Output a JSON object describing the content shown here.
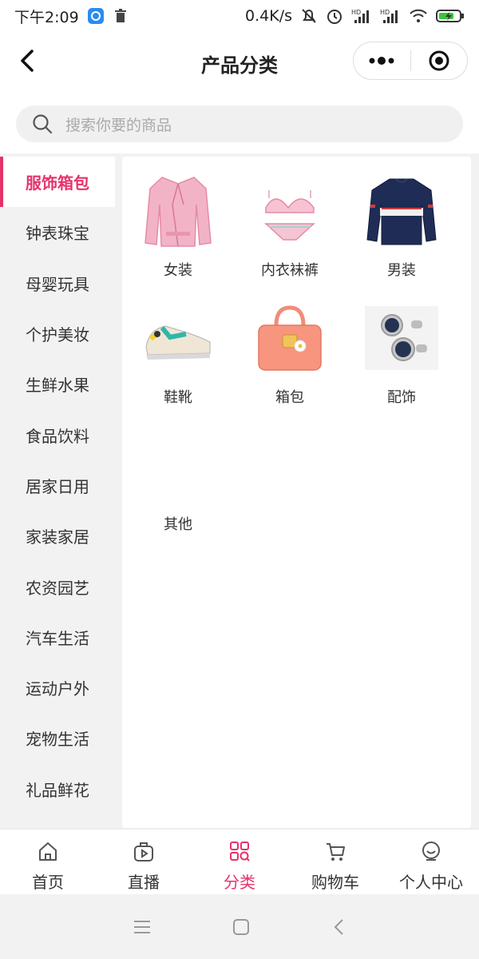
{
  "status": {
    "time": "下午2:09",
    "speed": "0.4K/s",
    "hd1": "HD",
    "hd2": "HD"
  },
  "nav": {
    "title": "产品分类"
  },
  "search": {
    "placeholder": "搜索你要的商品"
  },
  "sidebar": {
    "items": [
      {
        "label": "服饰箱包",
        "active": true
      },
      {
        "label": "钟表珠宝"
      },
      {
        "label": "母婴玩具"
      },
      {
        "label": "个护美妆"
      },
      {
        "label": "生鲜水果"
      },
      {
        "label": "食品饮料"
      },
      {
        "label": "居家日用"
      },
      {
        "label": "家装家居"
      },
      {
        "label": "农资园艺"
      },
      {
        "label": "汽车生活"
      },
      {
        "label": "运动户外"
      },
      {
        "label": "宠物生活"
      },
      {
        "label": "礼品鲜花"
      }
    ]
  },
  "categories": [
    {
      "label": "女装",
      "icon": "pink-jacket-image"
    },
    {
      "label": "内衣袜裤",
      "icon": "lingerie-image"
    },
    {
      "label": "男装",
      "icon": "sweater-image"
    },
    {
      "label": "鞋靴",
      "icon": "sneaker-image"
    },
    {
      "label": "箱包",
      "icon": "handbag-image"
    },
    {
      "label": "配饰",
      "icon": "cufflinks-image"
    },
    {
      "label": "其他",
      "icon": ""
    }
  ],
  "tabbar": {
    "items": [
      {
        "label": "首页",
        "icon": "home-icon"
      },
      {
        "label": "直播",
        "icon": "live-icon"
      },
      {
        "label": "分类",
        "icon": "category-icon",
        "active": true
      },
      {
        "label": "购物车",
        "icon": "cart-icon"
      },
      {
        "label": "个人中心",
        "icon": "profile-icon"
      }
    ]
  },
  "colors": {
    "accent": "#e5336a"
  }
}
